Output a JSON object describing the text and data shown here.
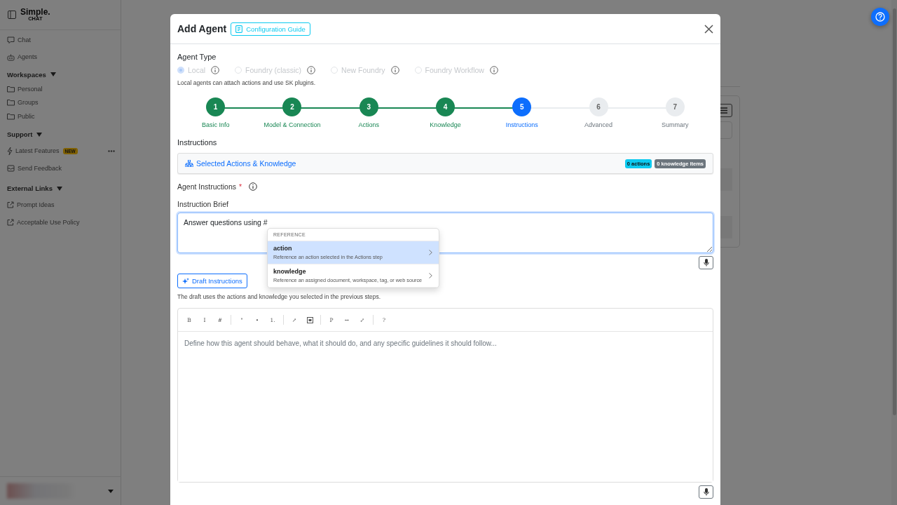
{
  "sidebar": {
    "logo": {
      "name": "Simple.",
      "sub": "CHAT"
    },
    "nav": [
      {
        "label": "Chat",
        "kind": "chat"
      },
      {
        "label": "Agents",
        "kind": "robot"
      }
    ],
    "sections": [
      {
        "title": "Workspaces",
        "items": [
          {
            "label": "Personal",
            "kind": "folder"
          },
          {
            "label": "Groups",
            "kind": "folder"
          },
          {
            "label": "Public",
            "kind": "folder"
          }
        ]
      },
      {
        "title": "Support",
        "items": [
          {
            "label": "Latest Features",
            "kind": "bolt",
            "badge": "NEW",
            "more": true
          },
          {
            "label": "Send Feedback",
            "kind": "mail",
            "more": false
          }
        ]
      },
      {
        "title": "External Links",
        "items": [
          {
            "label": "Prompt Ideas",
            "kind": "external"
          },
          {
            "label": "Acceptable Use Policy",
            "kind": "external"
          }
        ]
      }
    ]
  },
  "modal": {
    "title": "Add Agent",
    "guide_button": "Configuration Guide",
    "agent_type": {
      "label": "Agent Type",
      "options": [
        {
          "label": "Local",
          "selected": true,
          "disabled": true
        },
        {
          "label": "Foundry (classic)",
          "selected": false,
          "disabled": true
        },
        {
          "label": "New Foundry",
          "selected": false,
          "disabled": true
        },
        {
          "label": "Foundry Workflow",
          "selected": false,
          "disabled": true
        }
      ],
      "hint": "Local agents can attach actions and use SK plugins."
    },
    "steps": [
      {
        "number": "1",
        "label": "Basic Info",
        "completed": true,
        "selected": false
      },
      {
        "number": "2",
        "label": "Model & Connection",
        "completed": true,
        "selected": false
      },
      {
        "number": "3",
        "label": "Actions",
        "completed": true,
        "selected": false
      },
      {
        "number": "4",
        "label": "Knowledge",
        "completed": true,
        "selected": false
      },
      {
        "number": "5",
        "label": "Instructions",
        "completed": false,
        "selected": true
      },
      {
        "number": "6",
        "label": "Advanced",
        "completed": false,
        "selected": false
      },
      {
        "number": "7",
        "label": "Summary",
        "completed": false,
        "selected": false
      }
    ],
    "section_title": "Instructions",
    "selected_panel": {
      "title": "Selected Actions & Knowledge",
      "badges": [
        {
          "label": "0 actions",
          "color": "#0dcaf0"
        },
        {
          "label": "0 knowledge items",
          "color": "#6c757d"
        }
      ]
    },
    "instructions_label": "Agent Instructions",
    "required_mark": "*",
    "brief_label": "Instruction Brief",
    "brief_value": "Answer questions using #",
    "reference_menu": {
      "header": "REFERENCE",
      "items": [
        {
          "title": "action",
          "description": "Reference an action selected in the Actions step",
          "selected": true
        },
        {
          "title": "knowledge",
          "description": "Reference an assigned document, workspace, tag, or web source",
          "selected": false
        }
      ]
    },
    "draft_button": "Draft Instructions",
    "draft_hint": "The draft uses the actions and knowledge you selected in the previous steps.",
    "toolbar": [
      [
        {
          "kind": "text",
          "label": "B"
        },
        {
          "kind": "text",
          "label": "I"
        },
        {
          "kind": "text",
          "label": "#"
        }
      ],
      [
        {
          "kind": "text",
          "label": "\""
        },
        {
          "kind": "text",
          "label": "•"
        },
        {
          "kind": "text",
          "label": "1."
        }
      ],
      [
        {
          "kind": "text",
          "label": "↗"
        },
        {
          "kind": "image"
        }
      ],
      [
        {
          "kind": "text",
          "label": "P"
        },
        {
          "kind": "text",
          "label": "↔"
        },
        {
          "kind": "text",
          "label": "⤢"
        }
      ],
      [
        {
          "kind": "text",
          "label": "?"
        }
      ]
    ],
    "editor_placeholder": "Define how this agent should behave, what it should do, and any specific guidelines it should follow..."
  }
}
